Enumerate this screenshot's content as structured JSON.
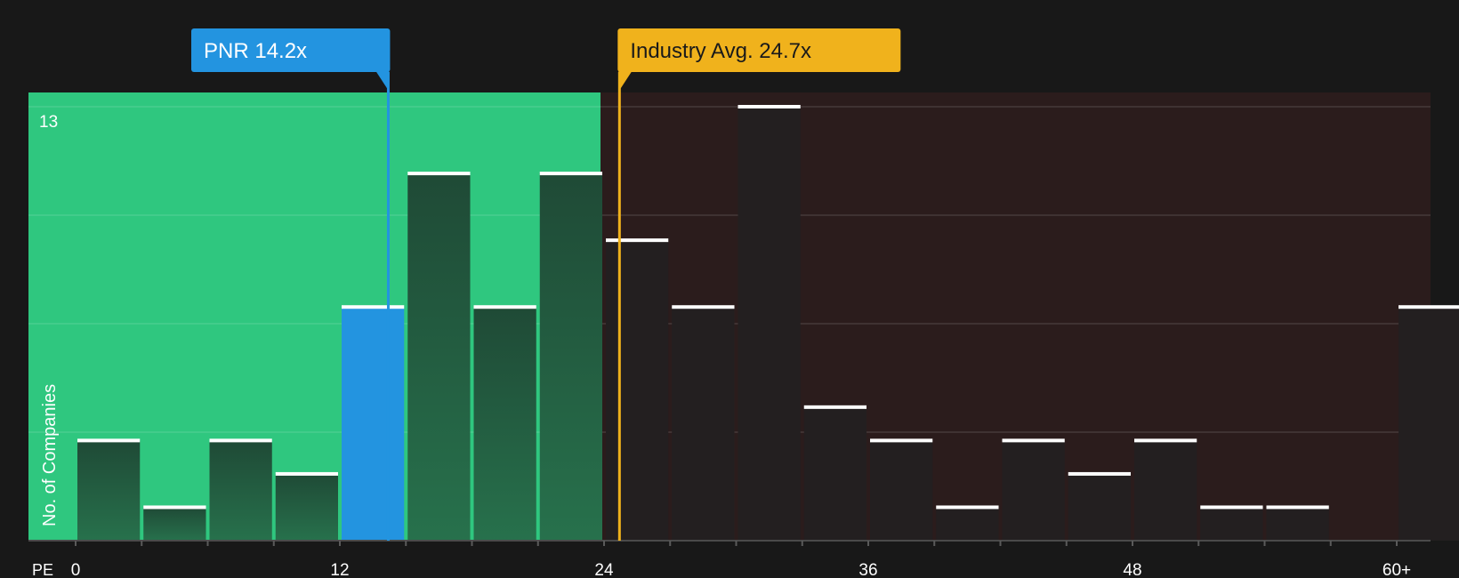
{
  "chart_data": {
    "type": "bar",
    "xlabel": "PE",
    "ylabel": "No. of Companies",
    "ymax_label": "13",
    "ylim": [
      0,
      13.5
    ],
    "bin_width": 3,
    "bins": [
      {
        "start": 0,
        "count": 3
      },
      {
        "start": 3,
        "count": 1
      },
      {
        "start": 6,
        "count": 3
      },
      {
        "start": 9,
        "count": 2
      },
      {
        "start": 12,
        "count": 7
      },
      {
        "start": 15,
        "count": 11
      },
      {
        "start": 18,
        "count": 7
      },
      {
        "start": 21,
        "count": 11
      },
      {
        "start": 24,
        "count": 9
      },
      {
        "start": 27,
        "count": 7
      },
      {
        "start": 30,
        "count": 13
      },
      {
        "start": 33,
        "count": 4
      },
      {
        "start": 36,
        "count": 3
      },
      {
        "start": 39,
        "count": 1
      },
      {
        "start": 42,
        "count": 3
      },
      {
        "start": 45,
        "count": 2
      },
      {
        "start": 48,
        "count": 3
      },
      {
        "start": 51,
        "count": 1
      },
      {
        "start": 54,
        "count": 1
      },
      {
        "start": 60,
        "count": 7
      }
    ],
    "x_ticks": [
      {
        "value": 0,
        "label": "0"
      },
      {
        "value": 12,
        "label": "12"
      },
      {
        "value": 24,
        "label": "24"
      },
      {
        "value": 36,
        "label": "36"
      },
      {
        "value": 48,
        "label": "48"
      },
      {
        "value": 60,
        "label": "60+"
      }
    ],
    "highlight_bin_start": 12,
    "markers": [
      {
        "id": "company",
        "label": "PNR 14.2x",
        "value": 14.2,
        "color": "#2394e0"
      },
      {
        "id": "industry",
        "label": "Industry Avg. 24.7x",
        "value": 24.7,
        "color": "#f0b21c"
      }
    ],
    "zones": {
      "good_until": 24,
      "good_color": "#2fc77f",
      "bad_color": "#2b1c1c"
    },
    "grid": true,
    "colors": {
      "background": "#181818",
      "bar_dark": "#231f20",
      "bar_highlight": "#2394e0",
      "bar_cap": "#ffffff"
    }
  }
}
